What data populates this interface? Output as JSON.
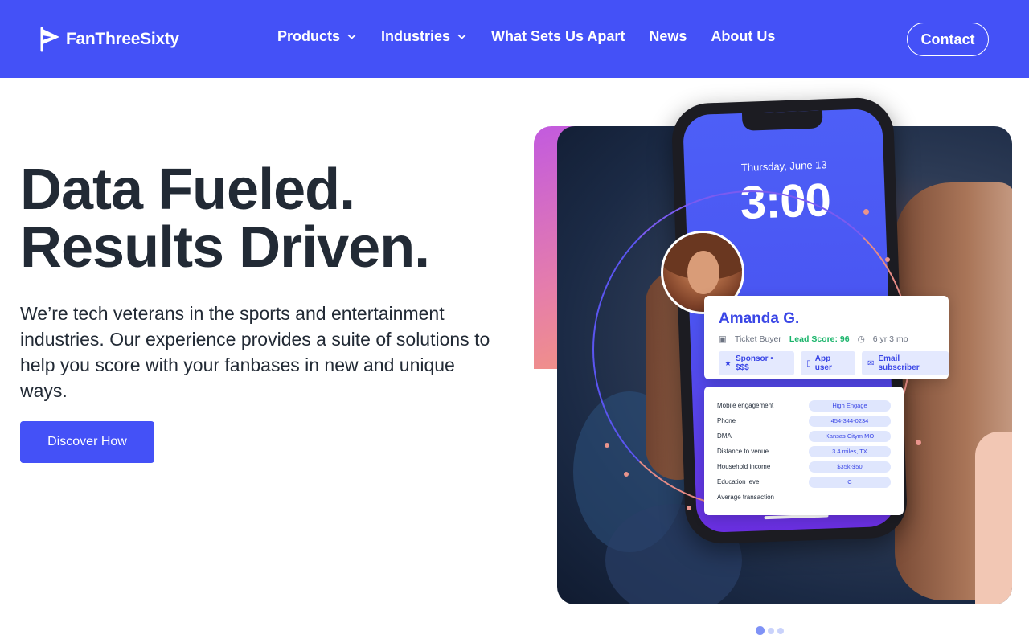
{
  "brand": {
    "name": "FanThreeSixty",
    "color": "#4451f7"
  },
  "nav": {
    "items": [
      {
        "label": "Products",
        "has_dropdown": true
      },
      {
        "label": "Industries",
        "has_dropdown": true
      },
      {
        "label": "What Sets Us Apart",
        "has_dropdown": false
      },
      {
        "label": "News",
        "has_dropdown": false
      },
      {
        "label": "About Us",
        "has_dropdown": false
      }
    ],
    "contact_label": "Contact"
  },
  "hero": {
    "title_line1": "Data Fueled.",
    "title_line2": "Results Driven.",
    "description": "We’re tech veterans in the sports and entertainment industries. Our experience provides a suite of solutions to help you score with your fanbases in new and unique ways.",
    "cta_label": "Discover How"
  },
  "phone": {
    "date": "Thursday, June 13",
    "time": "3:00"
  },
  "profile": {
    "name": "Amanda G.",
    "role": "Ticket Buyer",
    "lead_score": "Lead Score: 96",
    "tenure": "6 yr 3 mo",
    "tags": [
      "Sponsor • $$$",
      "App user",
      "Email subscriber"
    ]
  },
  "details": [
    {
      "label": "Mobile engagement",
      "value": "High Engage"
    },
    {
      "label": "Phone",
      "value": "454-344-0234"
    },
    {
      "label": "DMA",
      "value": "Kansas Citym MO"
    },
    {
      "label": "Distance to venue",
      "value": "3.4 miles, TX"
    },
    {
      "label": "Household income",
      "value": "$35k-$50"
    },
    {
      "label": "Education level",
      "value": "C"
    },
    {
      "label": "Average transaction",
      "value": ""
    }
  ],
  "carousel": {
    "slide_count": 3,
    "active_index": 0
  }
}
